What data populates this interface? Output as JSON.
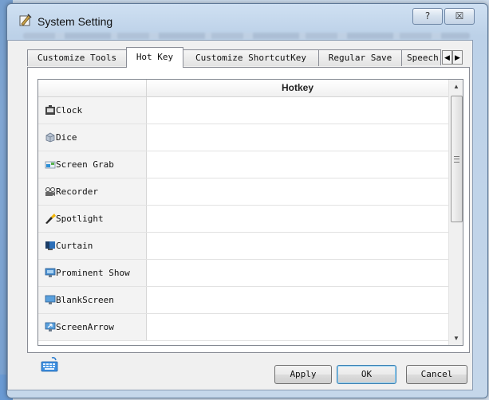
{
  "window": {
    "title": "System Setting",
    "help_label": "?",
    "close_label": "☒"
  },
  "tabs": [
    {
      "label": "Customize Tools",
      "active": false
    },
    {
      "label": "Hot Key",
      "active": true
    },
    {
      "label": "Customize ShortcutKey",
      "active": false
    },
    {
      "label": "Regular Save",
      "active": false
    },
    {
      "label": "Speech",
      "active": false
    }
  ],
  "tab_scroll": {
    "left": "◀",
    "right": "▶"
  },
  "grid": {
    "column_header": "Hotkey",
    "rows": [
      {
        "label": "Clock",
        "icon": "clock-icon",
        "hotkey": ""
      },
      {
        "label": "Dice",
        "icon": "dice-icon",
        "hotkey": ""
      },
      {
        "label": "Screen Grab",
        "icon": "screen-grab-icon",
        "hotkey": ""
      },
      {
        "label": "Recorder",
        "icon": "recorder-icon",
        "hotkey": ""
      },
      {
        "label": "Spotlight",
        "icon": "spotlight-icon",
        "hotkey": ""
      },
      {
        "label": "Curtain",
        "icon": "curtain-icon",
        "hotkey": ""
      },
      {
        "label": "Prominent Show",
        "icon": "prominent-show-icon",
        "hotkey": ""
      },
      {
        "label": "BlankScreen",
        "icon": "blank-screen-icon",
        "hotkey": ""
      },
      {
        "label": "ScreenArrow",
        "icon": "screen-arrow-icon",
        "hotkey": ""
      }
    ]
  },
  "footer": {
    "keyboard_icon": "keyboard-icon",
    "apply_label": "Apply",
    "ok_label": "OK",
    "cancel_label": "Cancel"
  },
  "colors": {
    "accent": "#3c7fb1",
    "titlebar": "#bcd1e8"
  }
}
